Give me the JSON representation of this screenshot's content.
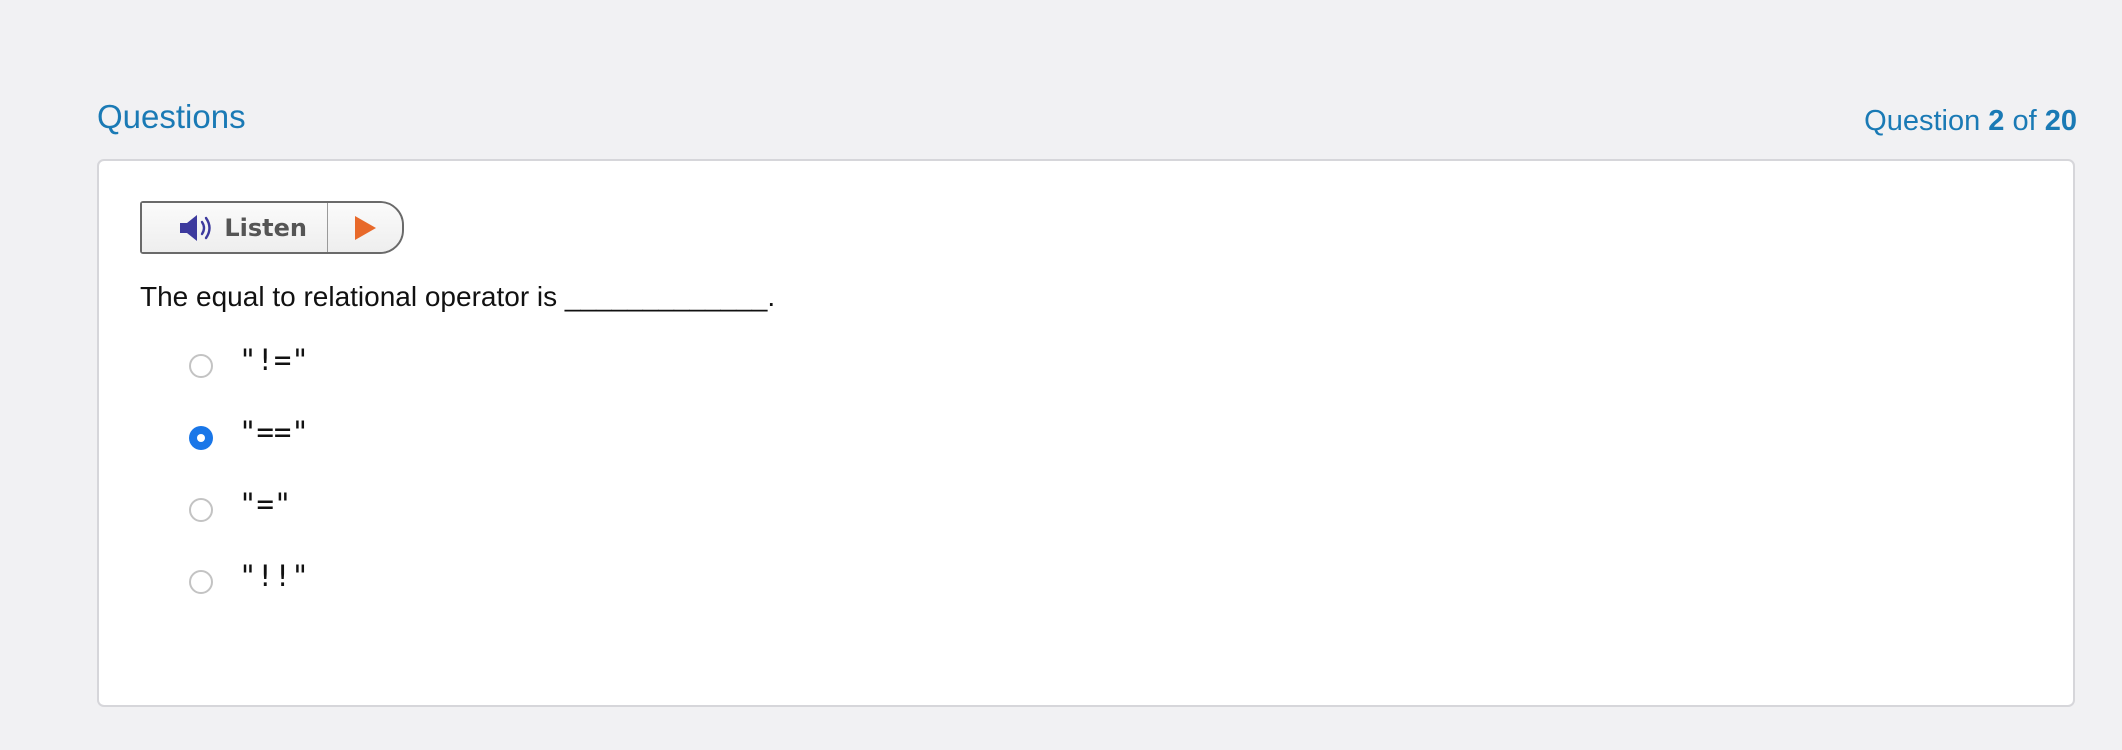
{
  "header": {
    "title": "Questions",
    "progress_prefix": "Question",
    "current": "2",
    "of_label": "of",
    "total": "20"
  },
  "listen": {
    "label": "Listen",
    "icon": "speaker-icon",
    "play_icon": "play-icon"
  },
  "question": {
    "text": "The equal to relational operator is _____________."
  },
  "options": [
    {
      "label": "\"!=\"",
      "selected": false
    },
    {
      "label": "\"==\"",
      "selected": true
    },
    {
      "label": "\"=\"",
      "selected": false
    },
    {
      "label": "\"!!\"",
      "selected": false
    }
  ],
  "colors": {
    "accent": "#1a7ab5",
    "radio_selected": "#1976e8",
    "play": "#e8692a",
    "speaker": "#3d3a9e"
  }
}
